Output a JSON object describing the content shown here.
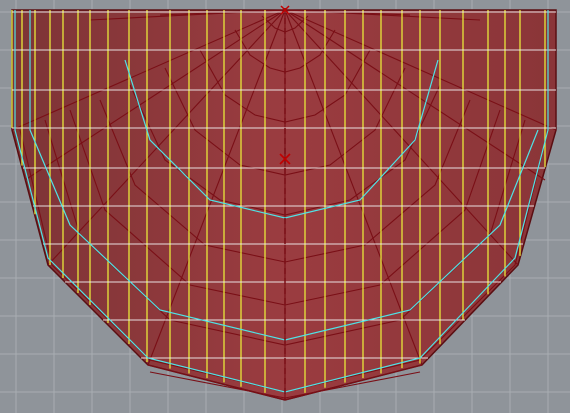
{
  "viewport": {
    "background": "#8f949a",
    "grid_color": "#a9adb2",
    "mesh_fill": "#8c3a3c",
    "mesh_edge_color": "#7a0f16",
    "yellow_line_color": "#e8e83a",
    "white_line_color": "#f2f2f2",
    "cyan_line_color": "#4fe3e6",
    "origin_marker": "x-marker"
  }
}
